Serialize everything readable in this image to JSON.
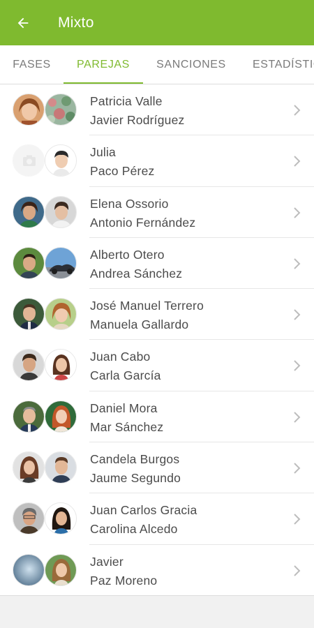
{
  "header": {
    "title": "Mixto",
    "background": "#7fba2f"
  },
  "tabs": [
    {
      "label": "FASES",
      "active": false
    },
    {
      "label": "PAREJAS",
      "active": true
    },
    {
      "label": "SANCIONES",
      "active": false
    },
    {
      "label": "ESTADÍSTIC",
      "active": false
    }
  ],
  "pairs": [
    {
      "player1": "Patricia Valle",
      "player2": "Javier Rodríguez"
    },
    {
      "player1": "Julia",
      "player2": "Paco Pérez"
    },
    {
      "player1": "Elena Ossorio",
      "player2": "Antonio Fernández"
    },
    {
      "player1": "Alberto Otero",
      "player2": "Andrea Sánchez"
    },
    {
      "player1": "José Manuel Terrero",
      "player2": "Manuela Gallardo"
    },
    {
      "player1": "Juan Cabo",
      "player2": "Carla García"
    },
    {
      "player1": "Daniel Mora",
      "player2": "Mar Sánchez"
    },
    {
      "player1": "Candela Burgos",
      "player2": "Jaume Segundo"
    },
    {
      "player1": "Juan Carlos Gracia",
      "player2": "Carolina Alcedo"
    },
    {
      "player1": "Javier",
      "player2": "Paz Moreno"
    }
  ]
}
